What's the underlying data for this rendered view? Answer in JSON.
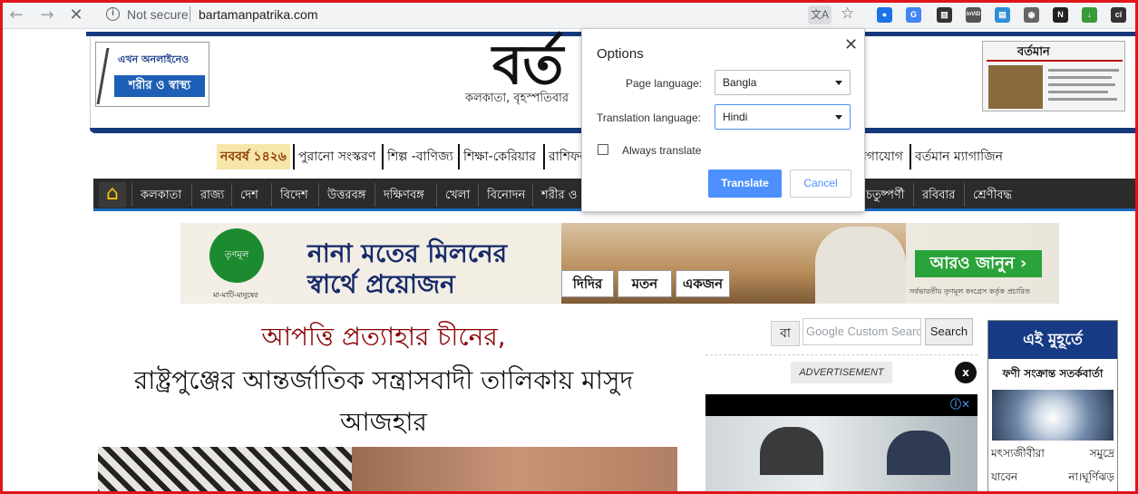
{
  "browser": {
    "security_label": "Not secure",
    "url": "bartamanpatrika.com",
    "extensions": [
      {
        "name": "ext-dot",
        "glyph": "●",
        "color": "#1a73e8"
      },
      {
        "name": "ext-translate",
        "glyph": "G",
        "color": "#4285f4"
      },
      {
        "name": "ext-museum",
        "glyph": "▥",
        "color": "#333333"
      },
      {
        "name": "ext-invid",
        "glyph": "InVID",
        "color": "#555555"
      },
      {
        "name": "ext-window",
        "glyph": "▤",
        "color": "#2d8fd6"
      },
      {
        "name": "ext-camera",
        "glyph": "◉",
        "color": "#666666"
      },
      {
        "name": "ext-n",
        "glyph": "N",
        "color": "#222222"
      },
      {
        "name": "ext-download",
        "glyph": "↓",
        "color": "#3a9a3a"
      },
      {
        "name": "ext-ci",
        "glyph": "ci",
        "color": "#333333"
      }
    ]
  },
  "site": {
    "ad_left_top": "এখন অনলাইনেও",
    "ad_left_main": "শরীর ও স্বাস্থ্য",
    "logo": "বর্ত",
    "dateline": "কলকাতা, বৃহস্পতিবার",
    "paper_thumb_title": "বর্তমান",
    "sub_nav": [
      {
        "label": "নববর্ষ ১৪২৬",
        "highlight": true
      },
      {
        "label": "পুরানো সংস্করণ"
      },
      {
        "label": "শিল্প -বাণিজ্য"
      },
      {
        "label": "শিক্ষা-কেরিয়ার"
      },
      {
        "label": "রাশিফল"
      },
      {
        "label": "যোগাযোগ"
      },
      {
        "label": "বর্তমান ম্যাগাজিন"
      }
    ],
    "main_nav": [
      "কলকাতা",
      "রাজ্য",
      "দেশ",
      "বিদেশ",
      "উত্তরবঙ্গ",
      "দক্ষিণবঙ্গ",
      "খেলা",
      "বিনোদন",
      "শরীর ও",
      "চতুষ্পর্ণী",
      "রবিবার",
      "শ্রেণীবদ্ধ"
    ],
    "banner": {
      "logo_text": "তৃণমূল",
      "logo_caption": "মা-মাটি-মানুষের",
      "slogan_line1": "নানা মতের মিলনের",
      "slogan_line2": "স্বার্থে প্রয়োজন",
      "cards": [
        "দিদির",
        "মতন",
        "একজন"
      ],
      "cta": "আরও জানুন ›",
      "fine_print": "সর্বভারতীয় তৃণমূল কংগ্রেস কর্তৃক প্রচারিত"
    },
    "headline_red": "আপত্তি প্রত্যাহার চীনের,",
    "headline_black_1": "রাষ্ট্রপুঞ্জের আন্তর্জাতিক সন্ত্রাসবাদী তালিকায় মাসুদ",
    "headline_black_2": "আজহার",
    "search": {
      "lang_label": "বা",
      "placeholder_brand": "Google",
      "placeholder": "Custom Search",
      "button": "Search"
    },
    "advertisement_label": "ADVERTISEMENT",
    "advertisement_close": "x",
    "moment": {
      "header": "এই মুহূর্তে",
      "subheader": "ফণী সংক্রান্ত সতর্কবার্তা",
      "line1_left": "মৎস্যজীবীরা",
      "line1_right": "সমুদ্রে",
      "line2_left": "যাবেন",
      "line2_right": "না।ঘূর্ণিঝড়"
    }
  },
  "translate_dialog": {
    "title": "Options",
    "page_language_label": "Page language:",
    "page_language_value": "Bangla",
    "translation_language_label": "Translation language:",
    "translation_language_value": "Hindi",
    "always_translate_label": "Always translate",
    "always_translate_checked": false,
    "translate_button": "Translate",
    "cancel_button": "Cancel"
  },
  "colors": {
    "frame_border": "#e1141b",
    "brand_blue": "#15397d",
    "primary_button": "#4d90fe"
  }
}
